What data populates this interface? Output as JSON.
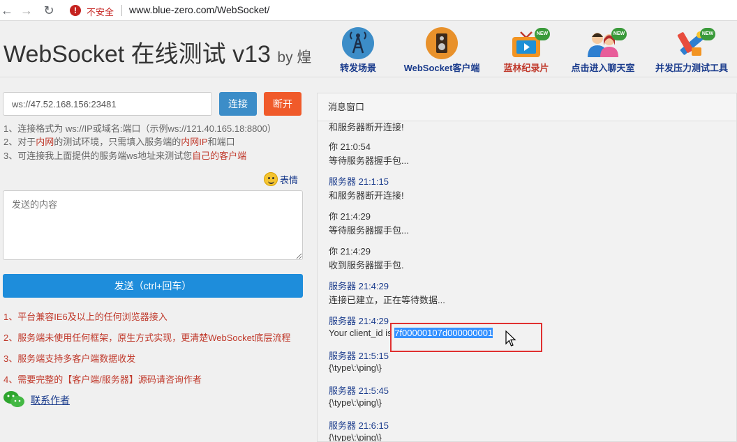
{
  "browser": {
    "back": "←",
    "forward": "→",
    "reload": "↻",
    "warn_symbol": "!",
    "security_label": "不安全",
    "url": "www.blue-zero.com/WebSocket/"
  },
  "header": {
    "title": "WebSocket 在线测试 v13",
    "by": "by 煌",
    "links": [
      {
        "label": "转发场景",
        "icon": "antenna-icon",
        "new": false
      },
      {
        "label": "WebSocket客户端",
        "icon": "speaker-icon",
        "new": false
      },
      {
        "label": "蓝林纪录片",
        "icon": "tv-icon",
        "new": true
      },
      {
        "label": "点击进入聊天室",
        "icon": "people-icon",
        "new": true
      },
      {
        "label": "并发压力测试工具",
        "icon": "tools-icon",
        "new": true
      }
    ],
    "new_badge": "NEW"
  },
  "connection": {
    "address": "ws://47.52.168.156:23481",
    "connect_label": "连接",
    "disconnect_label": "断开"
  },
  "tips": {
    "t1": "1、连接格式为 ws://IP或域名:端口（示例ws://121.40.165.18:8800）",
    "t2_a": "2、对于",
    "t2_b": "内网",
    "t2_c": "的测试环境，只需填入服务端的",
    "t2_d": "内网IP",
    "t2_e": "和端口",
    "t3_a": "3、可连接我上面提供的服务端ws地址来测试您",
    "t3_b": "自己的客户端"
  },
  "emoji_label": "表情",
  "send": {
    "placeholder": "发送的内容",
    "button_label": "发送（ctrl+回车）"
  },
  "features": [
    "1、平台兼容IE6及以上的任何浏览器接入",
    "2、服务端未使用任何框架，原生方式实现，更清楚WebSocket底层流程",
    "3、服务端支持多客户端数据收发",
    "4、需要完整的【客户端/服务器】源码请咨询作者"
  ],
  "contact_label": "联系作者",
  "messages_panel": {
    "title": "消息窗口",
    "partial_top": "和服务器断开连接!",
    "entries": [
      {
        "head": "你 21:0:54",
        "body": "等待服务器握手包...",
        "sender": "you"
      },
      {
        "head": "服务器 21:1:15",
        "body": "和服务器断开连接!",
        "sender": "server"
      },
      {
        "head": "你 21:4:29",
        "body": "等待服务器握手包...",
        "sender": "you"
      },
      {
        "head": "你 21:4:29",
        "body": "收到服务器握手包.",
        "sender": "you"
      },
      {
        "head": "服务器 21:4:29",
        "body": "连接已建立，正在等待数据...",
        "sender": "server"
      },
      {
        "head": "服务器 21:4:29",
        "body": "",
        "sender": "server"
      },
      {
        "head": "服务器 21:5:15",
        "body": "{\\type\\:\\ping\\}",
        "sender": "server"
      },
      {
        "head": "服务器 21:5:45",
        "body": "{\\type\\:\\ping\\}",
        "sender": "server"
      },
      {
        "head": "服务器 21:6:15",
        "body": "{\\type\\:\\ping\\}",
        "sender": "server"
      }
    ],
    "client_id_prefix": "Your client_id is ",
    "client_id": "7f00000107d000000001"
  },
  "colors": {
    "link_blue": "#1a3b8c",
    "connect_blue": "#3c8dc8",
    "disconnect_orange": "#f05a2a",
    "send_blue": "#1e8ddb",
    "highlight_red": "#e03030",
    "selection_blue": "#3390ff"
  }
}
